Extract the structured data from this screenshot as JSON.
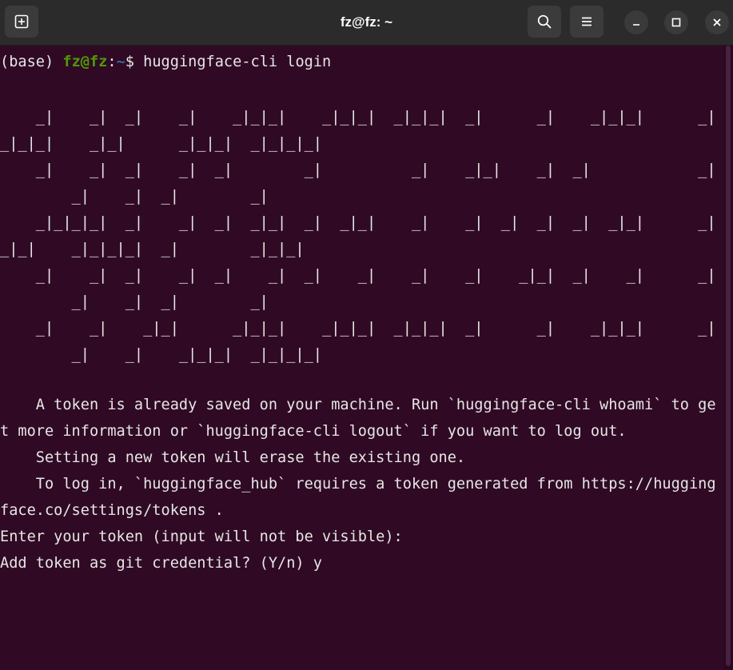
{
  "window": {
    "title": "fz@fz: ~",
    "icons": {
      "new_tab": "new-tab-icon",
      "search": "search-icon",
      "menu": "hamburger-menu-icon",
      "minimize": "minimize-icon",
      "maximize": "maximize-icon",
      "close": "close-icon"
    }
  },
  "prompt": {
    "env": "(base)",
    "user_host": "fz@fz",
    "colon": ":",
    "path": "~",
    "symbol": "$",
    "command": "huggingface-cli login"
  },
  "banner": [
    "    _|    _|  _|    _|    _|_|_|    _|_|_|  _|_|_|  _|      _|    _|_|_|      _|",
    "_|_|_|    _|_|      _|_|_|  _|_|_|_|",
    "    _|    _|  _|    _|  _|        _|          _|    _|_|    _|  _|            _|",
    "        _|    _|  _|        _|",
    "    _|_|_|_|  _|    _|  _|  _|_|  _|  _|_|    _|    _|  _|  _|  _|  _|_|      _|",
    "_|_|    _|_|_|_|  _|        _|_|_|",
    "    _|    _|  _|    _|  _|    _|  _|    _|    _|    _|    _|_|  _|    _|      _|",
    "        _|    _|  _|        _|",
    "    _|    _|    _|_|      _|_|_|    _|_|_|  _|_|_|  _|      _|    _|_|_|      _|",
    "        _|    _|    _|_|_|  _|_|_|_|"
  ],
  "messages": [
    "    A token is already saved on your machine. Run `huggingface-cli whoami` to ge",
    "t more information or `huggingface-cli logout` if you want to log out.",
    "    Setting a new token will erase the existing one.",
    "    To log in, `huggingface_hub` requires a token generated from https://hugging",
    "face.co/settings/tokens .",
    "Enter your token (input will not be visible):",
    "Add token as git credential? (Y/n) y"
  ],
  "colors": {
    "terminal_bg": "#300a24",
    "titlebar_bg": "#2b2b2b",
    "text": "#e6e6e6",
    "prompt_user": "#4e9a06",
    "prompt_path": "#3465a4"
  }
}
